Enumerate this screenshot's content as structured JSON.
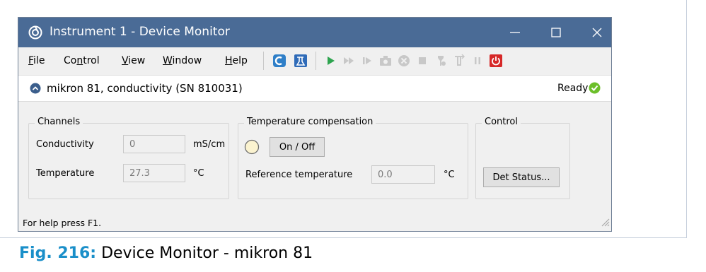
{
  "window": {
    "title": "Instrument 1 - Device Monitor",
    "controls": [
      "minimize",
      "maximize",
      "close"
    ]
  },
  "menu": {
    "file": {
      "mnemonic": "F",
      "rest": "ile"
    },
    "control": {
      "pre": "Co",
      "mnemonic": "n",
      "rest": "trol"
    },
    "view": {
      "mnemonic": "V",
      "rest": "iew"
    },
    "window": {
      "mnemonic": "W",
      "rest": "indow"
    },
    "help": {
      "mnemonic": "H",
      "rest": "elp"
    }
  },
  "toolbar_icons": [
    "connect-icon",
    "method-icon",
    "play-icon",
    "fast-forward-icon",
    "step-icon",
    "snapshot-icon",
    "abort-icon",
    "stop-icon",
    "purge-icon",
    "pump-icon",
    "pause-icon",
    "power-icon"
  ],
  "device": {
    "title": "mikron 81, conductivity (SN 810031)",
    "status": "Ready"
  },
  "channels": {
    "title": "Channels",
    "conductivity_label": "Conductivity",
    "conductivity_value": "0",
    "conductivity_unit": "mS/cm",
    "temperature_label": "Temperature",
    "temperature_value": "27.3",
    "temperature_unit": "°C"
  },
  "compensation": {
    "title": "Temperature compensation",
    "toggle_label": "On / Off",
    "reference_label": "Reference temperature",
    "reference_value": "0.0",
    "reference_unit": "°C"
  },
  "control": {
    "title": "Control",
    "det_status_label": "Det Status..."
  },
  "statusbar": {
    "text": "For help press F1."
  },
  "caption": {
    "figure": "Fig. 216:",
    "text": "Device Monitor - mikron 81"
  },
  "colors": {
    "titlebar": "#4a6b96",
    "caption_accent": "#1a8fc9",
    "ready_green": "#6cbf2a"
  }
}
